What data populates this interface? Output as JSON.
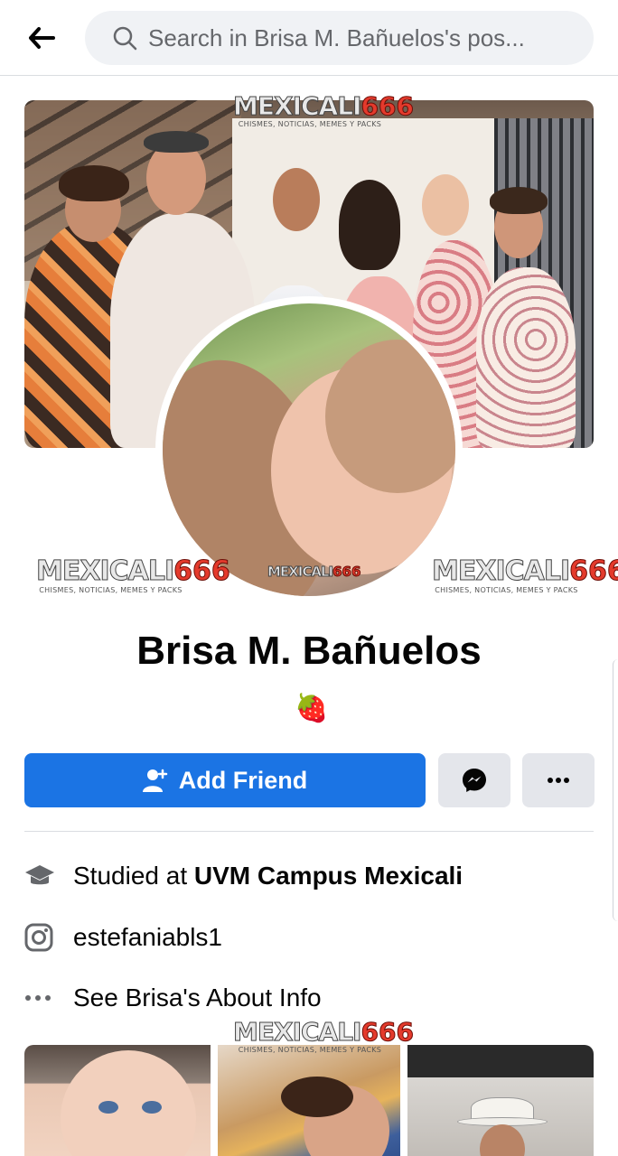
{
  "header": {
    "search_placeholder": "Search in Brisa M. Bañuelos's pos...",
    "back_icon": "arrow-left-icon",
    "search_icon": "search-icon"
  },
  "watermark": {
    "brand_a": "MEXICALI",
    "brand_b": "666",
    "tagline": "CHISMES, NOTICIAS, MEMES Y PACKS"
  },
  "profile": {
    "name": "Brisa M. Bañuelos",
    "emoji": "🍓"
  },
  "actions": {
    "add_friend_label": "Add Friend",
    "add_friend_icon": "person-add-icon",
    "message_icon": "messenger-icon",
    "more_icon": "more-dots-icon"
  },
  "info": {
    "studied_prefix": "Studied at ",
    "studied_school": "UVM Campus Mexicali",
    "instagram_handle": "estefaniabls1",
    "about_label": "See Brisa's About Info"
  },
  "colors": {
    "primary": "#1b74e4",
    "button_secondary": "#e4e6eb",
    "search_bg": "#f0f2f5",
    "text_secondary": "#65676b",
    "watermark_red": "#e43a2c"
  }
}
